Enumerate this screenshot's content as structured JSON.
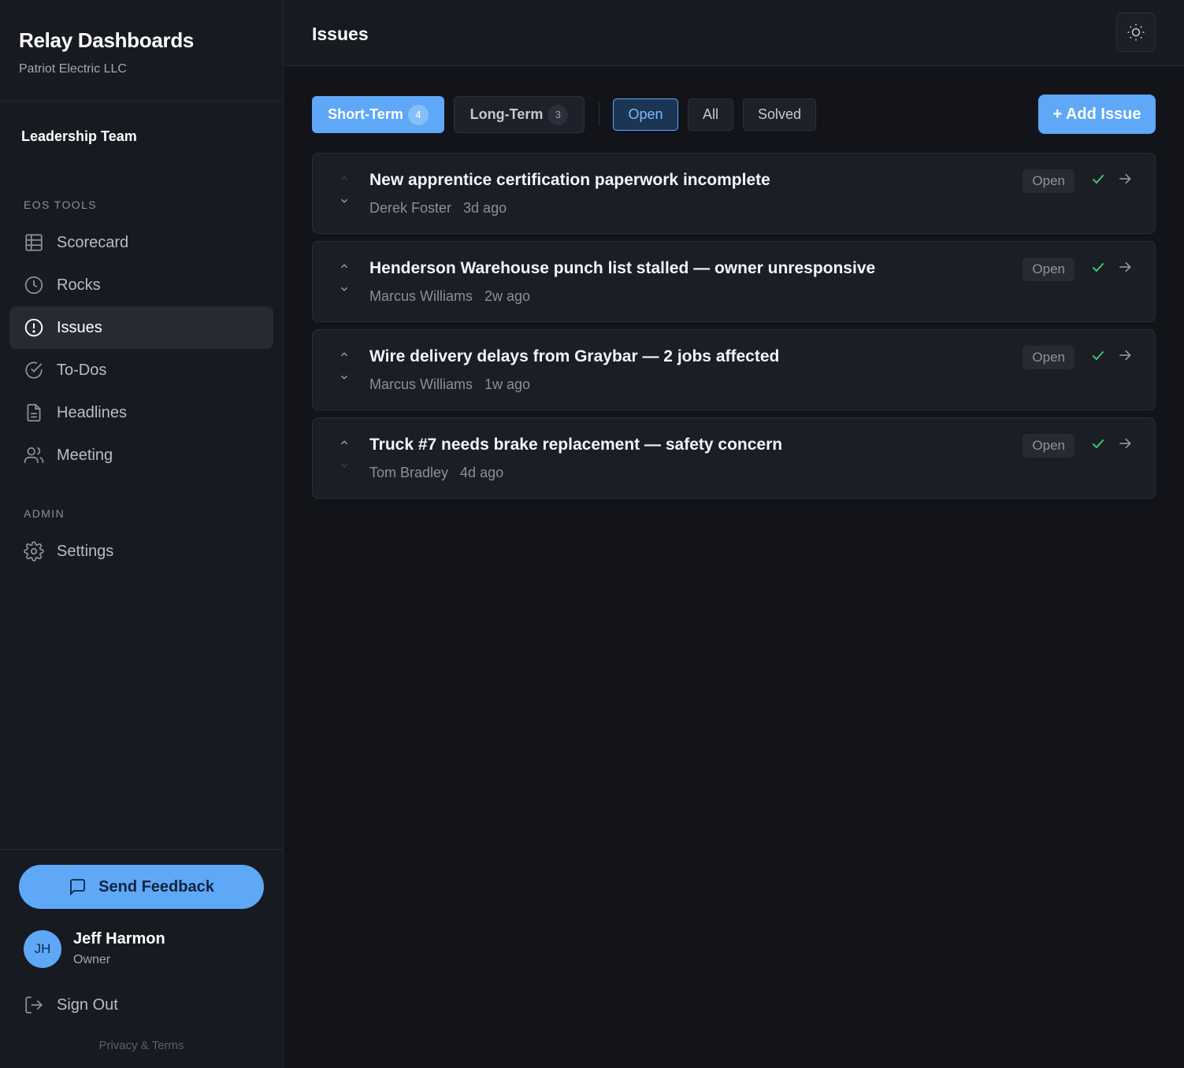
{
  "sidebar": {
    "brand_title": "Relay Dashboards",
    "brand_sub": "Patriot Electric LLC",
    "team": "Leadership Team",
    "eos_label": "EOS Tools",
    "admin_label": "ADMIN",
    "nav": {
      "scorecard": "Scorecard",
      "rocks": "Rocks",
      "issues": "Issues",
      "todos": "To-Dos",
      "headlines": "Headlines",
      "meeting": "Meeting",
      "settings": "Settings"
    },
    "feedback_label": "Send Feedback",
    "user": {
      "initials": "JH",
      "name": "Jeff Harmon",
      "role": "Owner"
    },
    "signout_label": "Sign Out",
    "privacy_label": "Privacy & Terms"
  },
  "header": {
    "title": "Issues"
  },
  "toolbar": {
    "short_term": {
      "label": "Short-Term",
      "count": "4"
    },
    "long_term": {
      "label": "Long-Term",
      "count": "3"
    },
    "filters": {
      "open": "Open",
      "all": "All",
      "solved": "Solved"
    },
    "add_label": "+ Add Issue"
  },
  "issues": [
    {
      "title": "New apprentice certification paperwork incomplete",
      "owner": "Derek Foster",
      "age": "3d ago",
      "status": "Open"
    },
    {
      "title": "Henderson Warehouse punch list stalled — owner unresponsive",
      "owner": "Marcus Williams",
      "age": "2w ago",
      "status": "Open"
    },
    {
      "title": "Wire delivery delays from Graybar — 2 jobs affected",
      "owner": "Marcus Williams",
      "age": "1w ago",
      "status": "Open"
    },
    {
      "title": "Truck #7 needs brake replacement — safety concern",
      "owner": "Tom Bradley",
      "age": "4d ago",
      "status": "Open"
    }
  ],
  "colors": {
    "accent": "#5ea8f7",
    "success": "#3fcf75",
    "background": "#12141a",
    "panel": "#181a21"
  }
}
